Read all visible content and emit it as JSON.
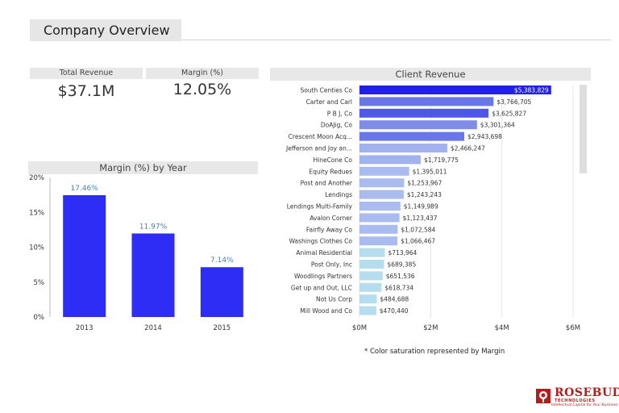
{
  "page": {
    "title": "Company Overview"
  },
  "kpis": {
    "revenue_label": "Total Revenue",
    "revenue_value": "$37.1M",
    "margin_label": "Margin (%)",
    "margin_value": "12.05%"
  },
  "footnote": "* Color saturation represented by Margin",
  "logo": {
    "name": "ROSEBUD",
    "sub": "TECHNOLOGIES",
    "tagline": "Intellectual Capital for Your Business"
  },
  "chart_data": [
    {
      "type": "bar",
      "title": "Margin (%) by Year",
      "categories": [
        "2013",
        "2014",
        "2015"
      ],
      "values": [
        17.46,
        11.97,
        7.14
      ],
      "data_labels": [
        "17.46%",
        "11.97%",
        "7.14%"
      ],
      "ylim": [
        0,
        20
      ],
      "yticks": [
        "0%",
        "5%",
        "10%",
        "15%",
        "20%"
      ],
      "colors": {
        "bar": "#2d2df5",
        "label": "#4a7fb5"
      },
      "grid": false
    },
    {
      "type": "bar",
      "orientation": "horizontal",
      "title": "Client Revenue",
      "categories": [
        "South Centies Co",
        "Carter and Carl",
        "P B J, Co",
        "DoAJig, Co",
        "Crescent Moon Acq...",
        "Jefferson and Joy an...",
        "HineCone Co",
        "Equity Redues",
        "Post and Another",
        "Lendings",
        "Lendings Multi-Family",
        "Avalon Corner",
        "Fairfly Away Co",
        "Washings Clothes Co",
        "Animal Residential",
        "Post Only, Inc",
        "Woodlings Partners",
        "Get up and Out, LLC",
        "Not Us Corp",
        "Mill Wood and Co"
      ],
      "values": [
        5383829,
        3766705,
        3625827,
        3301364,
        2943698,
        2466247,
        1719775,
        1395011,
        1253967,
        1243243,
        1149989,
        1123437,
        1072584,
        1066467,
        713964,
        689385,
        651536,
        618734,
        484688,
        470440
      ],
      "data_labels": [
        "$5,383,829",
        "$3,766,705",
        "$3,625,827",
        "$3,301,364",
        "$2,943,698",
        "$2,466,247",
        "$1,719,775",
        "$1,395,011",
        "$1,253,967",
        "$1,243,243",
        "$1,149,989",
        "$1,123,437",
        "$1,072,584",
        "$1,066,467",
        "$713,964",
        "$689,385",
        "$651,536",
        "$618,734",
        "$484,688",
        "$470,440"
      ],
      "colors": [
        "#2121e6",
        "#6a75e8",
        "#4e58e6",
        "#7f8ce8",
        "#6a75e8",
        "#a2b2ee",
        "#a2b2ee",
        "#a9bbef",
        "#a9bbef",
        "#a9bbef",
        "#a9bbef",
        "#a9bbef",
        "#a9bbef",
        "#a9bbef",
        "#b6dcef",
        "#b6dcef",
        "#b6dcef",
        "#b6dcef",
        "#b6dcef",
        "#b6dcef"
      ],
      "xlim": [
        0,
        6000000
      ],
      "xticks": [
        "$0M",
        "$2M",
        "$4M",
        "$6M"
      ],
      "grid": true
    }
  ]
}
